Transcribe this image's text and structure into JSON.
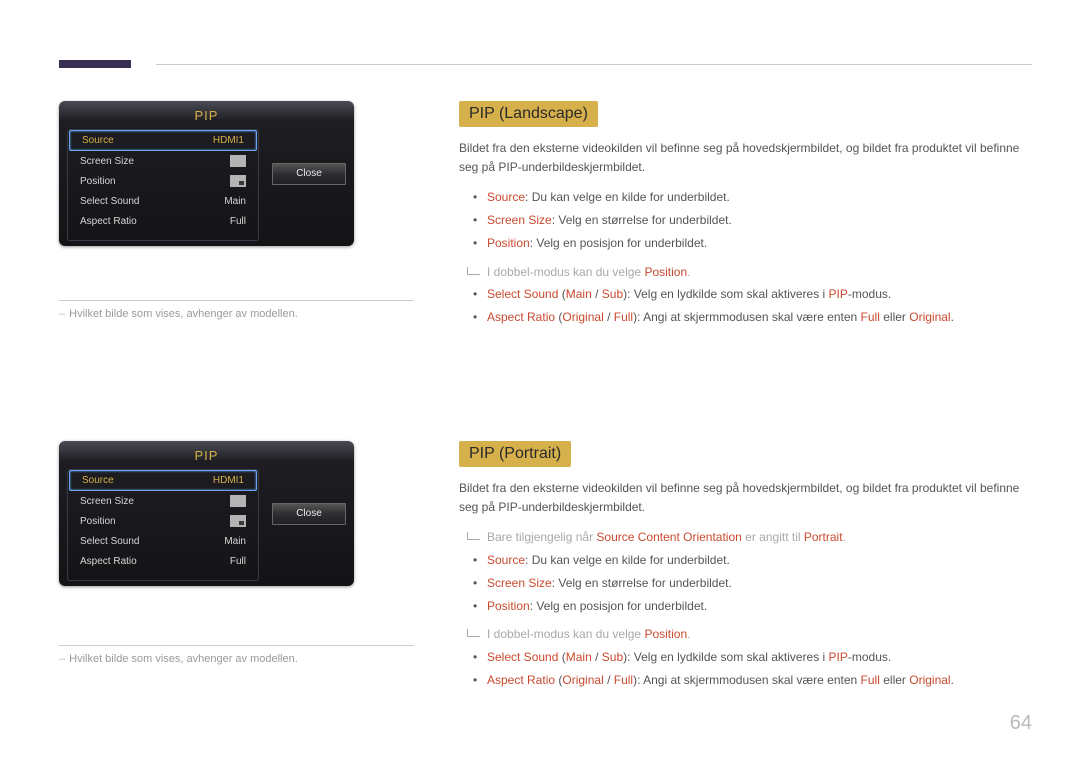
{
  "page_number": "64",
  "caption": "Hvilket bilde som vises, avhenger av modellen.",
  "osd": {
    "title": "PIP",
    "close": "Close",
    "rows": [
      {
        "label": "Source",
        "value": "HDMI1",
        "selected": true
      },
      {
        "label": "Screen Size",
        "value": "",
        "icon": "pip-size"
      },
      {
        "label": "Position",
        "value": "",
        "icon": "pip-pos"
      },
      {
        "label": "Select Sound",
        "value": "Main"
      },
      {
        "label": "Aspect Ratio",
        "value": "Full"
      }
    ]
  },
  "sections": [
    {
      "heading": "PIP (Landscape)",
      "intro": "Bildet fra den eksterne videokilden vil befinne seg på hovedskjermbildet, og bildet fra produktet vil befinne seg på PIP-underbildeskjermbildet.",
      "pre_note": null,
      "bul1": {
        "source": ": Du kan velge en kilde for underbildet.",
        "screensize": ": Velg en størrelse for underbildet.",
        "position": ": Velg en posisjon for underbildet."
      },
      "note_position_pre": "I dobbel-modus kan du velge ",
      "note_position_hl": "Position",
      "bul2": {
        "selectsound_a": "Select Sound",
        "selectsound_b": " (",
        "selectsound_c": "Main",
        "selectsound_d": " / ",
        "selectsound_e": "Sub",
        "selectsound_f": "): Velg en lydkilde som skal aktiveres i ",
        "selectsound_g": "PIP",
        "selectsound_h": "-modus.",
        "aspect_a": "Aspect Ratio",
        "aspect_b": " (",
        "aspect_c": "Original",
        "aspect_d": " / ",
        "aspect_e": "Full",
        "aspect_f": "): Angi at skjermmodusen skal være enten ",
        "aspect_g": "Full",
        "aspect_h": " eller ",
        "aspect_i": "Original",
        "aspect_j": "."
      }
    },
    {
      "heading": "PIP (Portrait)",
      "intro": "Bildet fra den eksterne videokilden vil befinne seg på hovedskjermbildet, og bildet fra produktet vil befinne seg på PIP-underbildeskjermbildet.",
      "pre_note": {
        "a": "Bare tilgjengelig når ",
        "b": "Source Content Orientation",
        "c": " er angitt til ",
        "d": "Portrait",
        "e": "."
      },
      "bul1": {
        "source": ": Du kan velge en kilde for underbildet.",
        "screensize": ": Velg en størrelse for underbildet.",
        "position": ": Velg en posisjon for underbildet."
      },
      "note_position_pre": "I dobbel-modus kan du velge ",
      "note_position_hl": "Position",
      "bul2": {
        "selectsound_a": "Select Sound",
        "selectsound_b": " (",
        "selectsound_c": "Main",
        "selectsound_d": " / ",
        "selectsound_e": "Sub",
        "selectsound_f": "): Velg en lydkilde som skal aktiveres i ",
        "selectsound_g": "PIP",
        "selectsound_h": "-modus.",
        "aspect_a": "Aspect Ratio",
        "aspect_b": " (",
        "aspect_c": "Original",
        "aspect_d": " / ",
        "aspect_e": "Full",
        "aspect_f": "): Angi at skjermmodusen skal være enten ",
        "aspect_g": "Full",
        "aspect_h": " eller ",
        "aspect_i": "Original",
        "aspect_j": "."
      }
    }
  ],
  "keywords": {
    "source": "Source",
    "screensize": "Screen Size",
    "position": "Position"
  }
}
